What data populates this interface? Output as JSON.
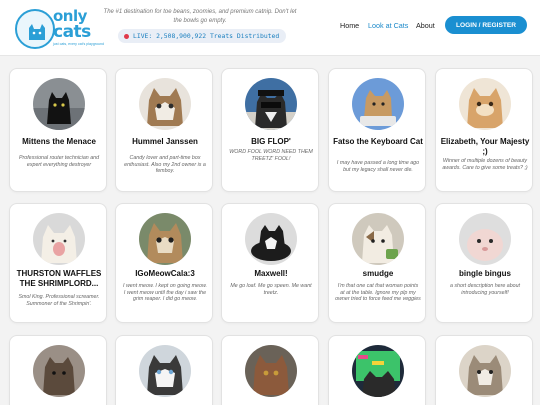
{
  "header": {
    "logo": {
      "only": "only",
      "cats": "cats",
      "tagline": "just cats, every cat's playground",
      "icon": "cat-logo-icon"
    },
    "tagline": "The #1 destination for toe beans, zoomies, and premium catnip. Don't let the bowls go empty.",
    "live_ticker": "LIVE: 2,508,900,922 Treats Distributed",
    "nav": {
      "home": "Home",
      "look": "Look at Cats",
      "about": "About"
    },
    "login_label": "LOGIN / REGISTER",
    "colors": {
      "brand": "#2b9fd6",
      "button": "#1a8fd1",
      "live_dot": "#e0394a"
    }
  },
  "cats": [
    {
      "name": "Mittens the Menace",
      "desc": "Professional router technician and expert everything destroyer"
    },
    {
      "name": "Hummel Janssen",
      "desc": "Candy lover and part-time box enthusiast. Also my 2nd owner is a femboy."
    },
    {
      "name": "BIG FLOP'",
      "desc": "WORD FOOL WORD NEED THEM TREETZ' FOOL!"
    },
    {
      "name": "Fatso the Keyboard Cat",
      "desc": "I may have passed a long time ago but my legacy shall never die."
    },
    {
      "name": "Elizabeth, Your Majesty ;)",
      "desc": "Winner of multiple dozens of beauty awards.  Care to give some treats? ;)"
    },
    {
      "name": "THURSTON WAFFLES THE SHRIMPLORD...",
      "desc": "Smol King. Professional screamer. Summoner of the Shrimpin'."
    },
    {
      "name": "IGoMeowCala:3",
      "desc": "I went meow. I kept on going meow. I went meow until the day i saw the grim reaper. I did go meow."
    },
    {
      "name": "Maxwell!",
      "desc": "Me go loaf. Me go speen. Me want treetz."
    },
    {
      "name": "smudge",
      "desc": "I'm that one cat that woman points at at the table. Ignore my plp my owner tried to force feed me veggies"
    },
    {
      "name": "bingle bingus",
      "desc": "a short description here about introducing yourself!"
    },
    {
      "name": "",
      "desc": ""
    },
    {
      "name": "",
      "desc": ""
    },
    {
      "name": "",
      "desc": ""
    },
    {
      "name": "",
      "desc": ""
    },
    {
      "name": "",
      "desc": ""
    }
  ]
}
